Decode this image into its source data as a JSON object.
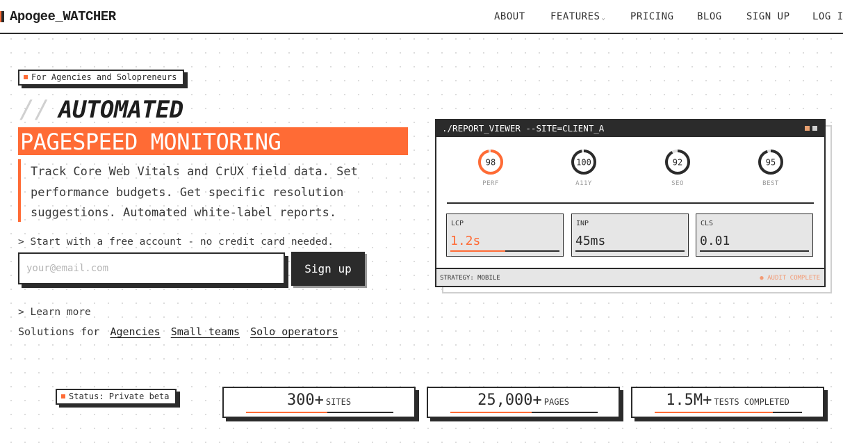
{
  "brand": {
    "name": "Apogee_WATCHER"
  },
  "nav": {
    "items": [
      {
        "label": "ABOUT"
      },
      {
        "label": "FEATURES"
      },
      {
        "label": "PRICING"
      },
      {
        "label": "BLOG"
      },
      {
        "label": "SIGN UP"
      },
      {
        "label": "LOG IN"
      }
    ]
  },
  "hero": {
    "tag": "For Agencies and Solopreneurs",
    "slashes": "//",
    "title_line1": "AUTOMATED",
    "title_line2": "PAGESPEED MONITORING",
    "description": "Track Core Web Vitals and CrUX field data. Set performance budgets. Get specific resolution suggestions. Automated white-label reports.",
    "cta_text": "> Start with a free account - no credit card needed.",
    "email_placeholder": "your@email.com",
    "signup_label": "Sign up",
    "learn_more": "> Learn more",
    "solutions_prefix": "Solutions for",
    "solutions": [
      "Agencies",
      "Small teams",
      "Solo operators"
    ]
  },
  "report": {
    "title": "./REPORT_VIEWER --SITE=CLIENT_A",
    "scores": [
      {
        "value": "98",
        "label": "PERF",
        "fraction": 0.98,
        "color": "#ff6b35"
      },
      {
        "value": "100",
        "label": "A11Y",
        "fraction": 1.0,
        "color": "#2b2b2b"
      },
      {
        "value": "92",
        "label": "SEO",
        "fraction": 0.92,
        "color": "#2b2b2b"
      },
      {
        "value": "95",
        "label": "BEST",
        "fraction": 0.95,
        "color": "#2b2b2b"
      }
    ],
    "metrics": [
      {
        "name": "LCP",
        "value": "1.2s",
        "color": "#ff6b35",
        "fill": 0.5
      },
      {
        "name": "INP",
        "value": "45ms",
        "color": "#2b2b2b",
        "fill": 0
      },
      {
        "name": "CLS",
        "value": "0.01",
        "color": "#2b2b2b",
        "fill": 0
      }
    ],
    "strategy": "STRATEGY: MOBILE",
    "status": "● AUDIT COMPLETE"
  },
  "status_tag": "Status: Private beta",
  "stats": [
    {
      "number": "300+",
      "unit": "SITES",
      "fill": 0.55
    },
    {
      "number": "25,000+",
      "unit": "PAGES",
      "fill": 0.55
    },
    {
      "number": "1.5M+",
      "unit": "TESTS COMPLETED",
      "fill": 0.8
    }
  ],
  "colors": {
    "accent": "#ff6b35",
    "ink": "#2b2b2b"
  },
  "icons": {
    "brand": "brand-mark-icon",
    "dropdown": "chevron-down-icon",
    "bullet": "square-bullet-icon"
  }
}
